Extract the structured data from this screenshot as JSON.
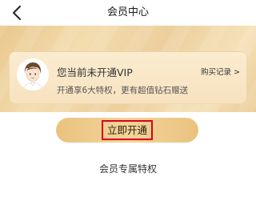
{
  "header": {
    "title": "会员中心",
    "back_icon": "chevron-left-icon"
  },
  "status_card": {
    "avatar_icon": "user-avatar",
    "title": "您当前未开通VIP",
    "subtitle": "开通享6大特权，更有超值钻石赠送",
    "purchase_record_label": "购买记录 >"
  },
  "actions": {
    "open_now_label": "立即开通"
  },
  "section": {
    "title": "会员专属特权"
  },
  "colors": {
    "gold_light": "#f3dcae",
    "gold_dark": "#e9c88d",
    "button_gold": "#eac27f",
    "highlight_red": "#d9001b"
  }
}
